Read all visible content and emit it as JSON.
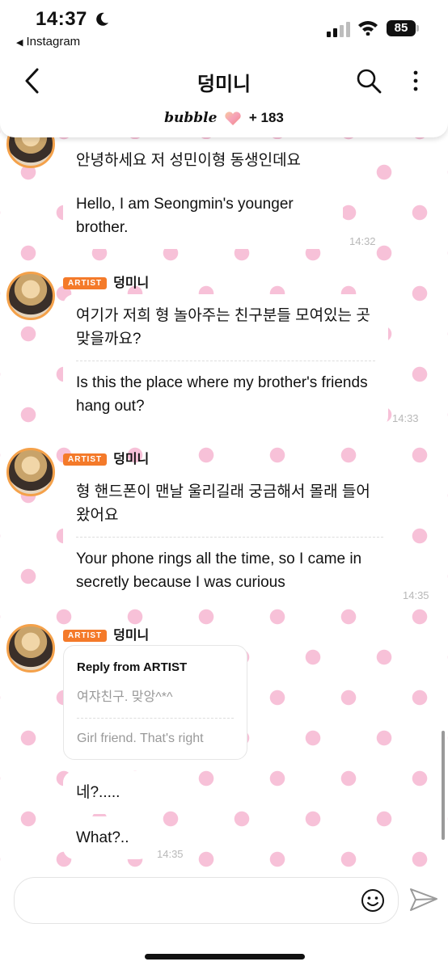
{
  "status": {
    "time": "14:37",
    "back_app": "Instagram",
    "battery": "85"
  },
  "header": {
    "title": "덩미니",
    "brand": "bubble",
    "count": "+ 183"
  },
  "icons": {
    "back": "chevron-left-icon",
    "search": "search-icon",
    "more": "more-vertical-icon",
    "emoji": "smile-icon",
    "send": "send-icon",
    "heart": "heart-icon",
    "moon": "moon-icon"
  },
  "colors": {
    "artist_badge": "#f47a2a",
    "dots": "#f7c1d8",
    "avatar_ring": "#f4a14a"
  },
  "messages": [
    {
      "ko": "안녕하세요 저 성민이형 동생인데요",
      "en": "Hello, I am Seongmin's younger brother.",
      "time": "14:32"
    },
    {
      "badge": "ARTIST",
      "name": "덩미니",
      "ko": "여기가 저희 형 놀아주는 친구분들 모여있는 곳 맞을까요?",
      "en": "Is this the place where my brother's friends hang out?",
      "time": "14:33"
    },
    {
      "badge": "ARTIST",
      "name": "덩미니",
      "ko": "형 핸드폰이 맨날 울리길래 궁금해서 몰래 들어왔어요",
      "en": "Your phone rings all the time, so I came in secretly because I was curious",
      "time": "14:35"
    },
    {
      "badge": "ARTIST",
      "name": "덩미니",
      "reply_title": "Reply from ARTIST",
      "reply_ko": "여쟈친구. 맞앙^*^",
      "reply_en": "Girl friend. That's right",
      "ko": "네?.....",
      "en": "What?..",
      "time": "14:35"
    }
  ]
}
